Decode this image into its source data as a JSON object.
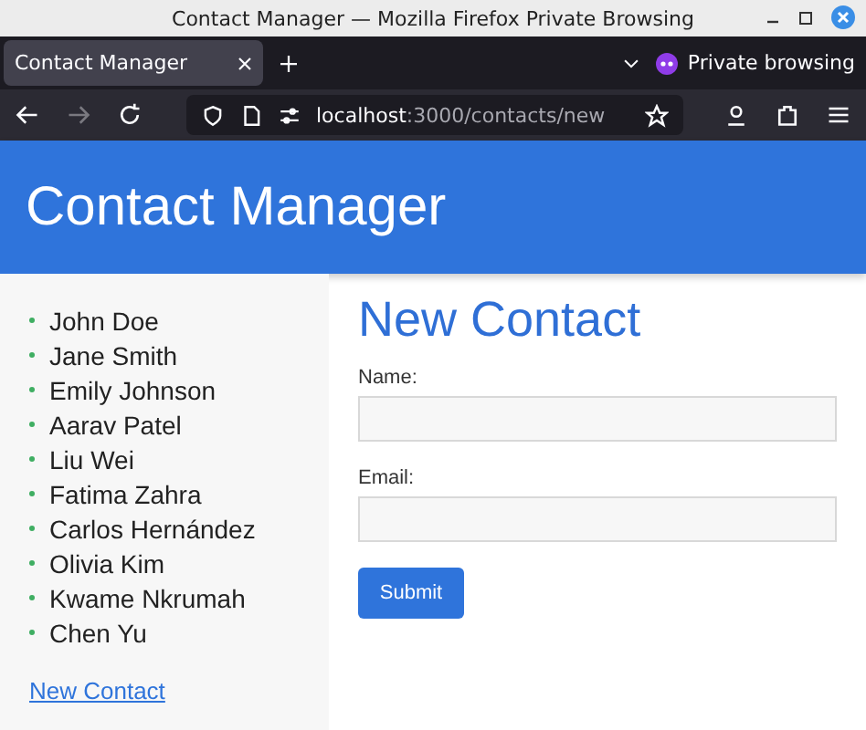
{
  "window": {
    "title": "Contact Manager — Mozilla Firefox Private Browsing"
  },
  "tabs": [
    {
      "label": "Contact Manager",
      "selected": true
    }
  ],
  "private_label": "Private browsing",
  "address": {
    "host": "localhost",
    "path": ":3000/contacts/new"
  },
  "header": {
    "title": "Contact Manager"
  },
  "contacts": [
    "John Doe",
    "Jane Smith",
    "Emily Johnson",
    "Aarav Patel",
    "Liu Wei",
    "Fatima Zahra",
    "Carlos Hernández",
    "Olivia Kim",
    "Kwame Nkrumah",
    "Chen Yu"
  ],
  "new_contact_link": "New Contact",
  "form": {
    "heading": "New Contact",
    "fields": [
      {
        "label": "Name:"
      },
      {
        "label": "Email:"
      }
    ],
    "submit": "Submit"
  }
}
